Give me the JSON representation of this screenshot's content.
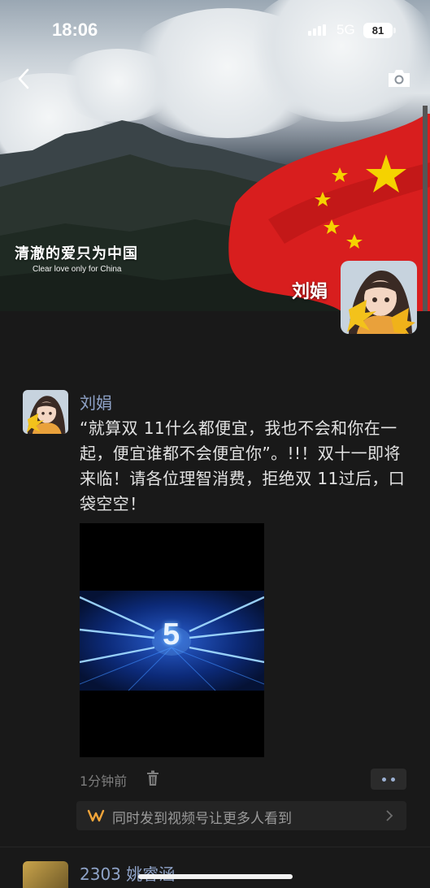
{
  "status_bar": {
    "time": "18:06",
    "network": "5G",
    "battery": "81"
  },
  "cover": {
    "title": "清澈的爱只为中国",
    "subtitle": "Clear love only for China",
    "owner_name": "刘娟"
  },
  "post": {
    "author": "刘娟",
    "text": "“就算双 11什么都便宜，我也不会和你在一起，便宜谁都不会便宜你”。!!！双十一即将来临！请各位理智消费，拒绝双 11过后，口袋空空！",
    "video_overlay": "5",
    "time_ago": "1分钟前",
    "promo_text": "同时发到视频号让更多人看到"
  },
  "next_post": {
    "author": "2303 姚睿涵"
  },
  "colors": {
    "background": "#191919",
    "name_link": "#8fa3c8",
    "flag_red": "#d81e1e",
    "promo_icon": "#f2a53a"
  }
}
